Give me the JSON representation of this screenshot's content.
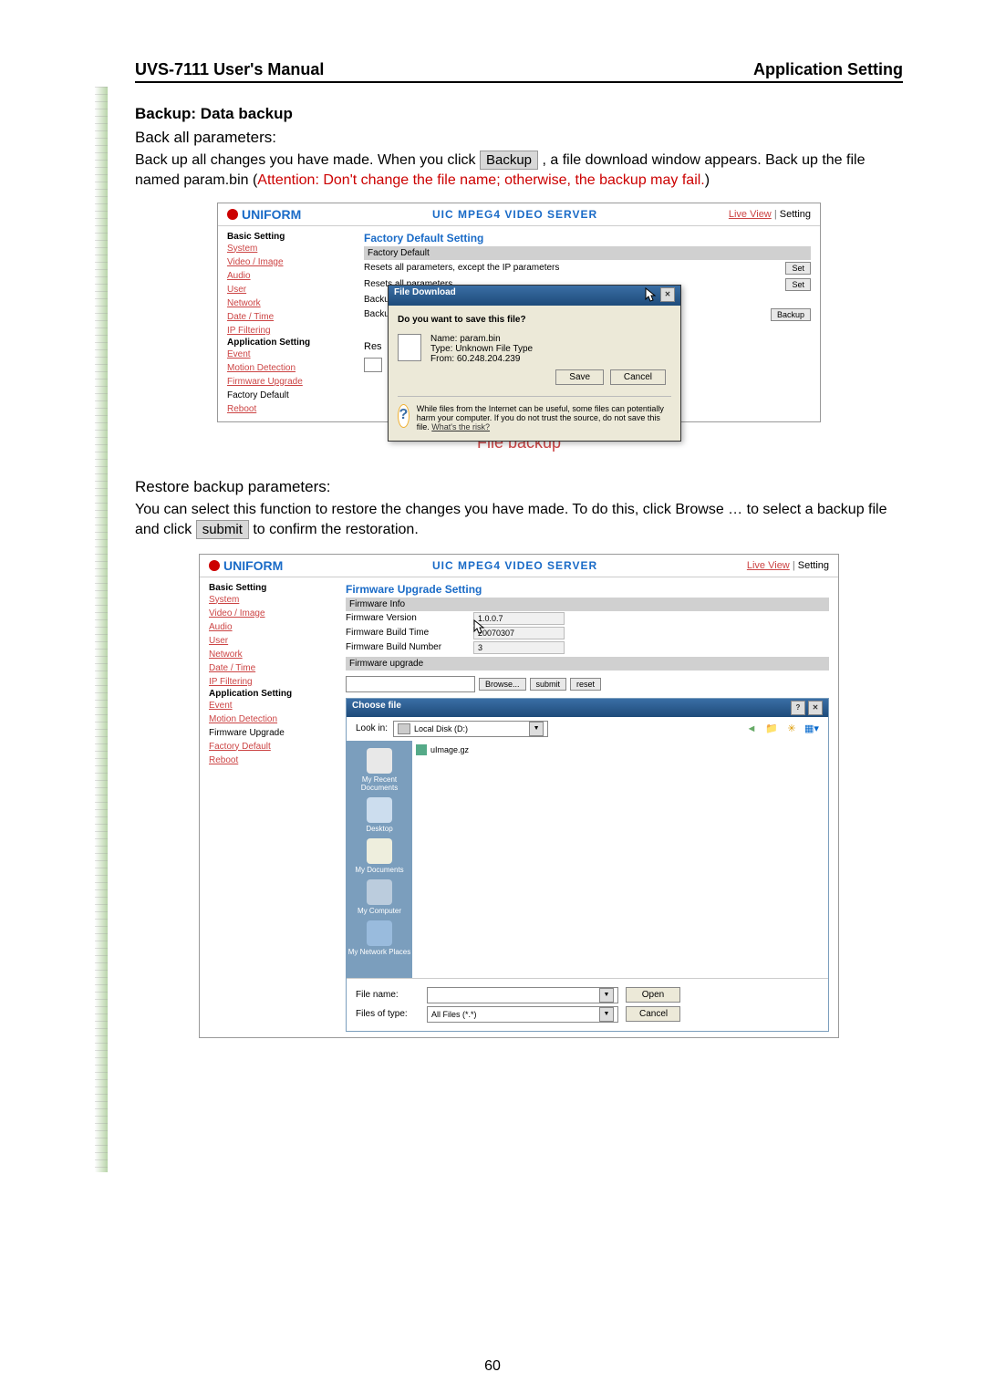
{
  "header": {
    "left": "UVS-7111 User's Manual",
    "right": "Application Setting"
  },
  "section": {
    "title": "Backup: Data backup",
    "subtitle": "Back all parameters:",
    "body_pre": "Back up all changes you have made. When you click ",
    "backup_btn": "Backup",
    "body_post": " , a file download window appears. Back up the file named param.bin (",
    "attention": "Attention: Don't change the file name; otherwise, the backup may fail.",
    "body_close": ")"
  },
  "fig1": {
    "uniform": "UNIFORM",
    "server": "UIC MPEG4 VIDEO SERVER",
    "live": "Live View",
    "setting": "Setting",
    "nav": {
      "basic": "Basic Setting",
      "items": [
        "System",
        "Video / Image",
        "Audio",
        "User",
        "Network",
        "Date / Time",
        "IP Filtering"
      ],
      "app": "Application Setting",
      "app_items": [
        "Event",
        "Motion Detection",
        "Firmware Upgrade",
        "Factory Default",
        "Reboot"
      ]
    },
    "main": {
      "title": "Factory Default Setting",
      "sub": "Factory Default",
      "row1": "Resets all parameters, except the IP parameters",
      "row2": "Resets all parameters",
      "set": "Set",
      "backup_lbl1": "Backup",
      "backup_lbl2": "Backup",
      "backup_btn": "Backup",
      "res": "Res"
    },
    "dialog": {
      "title": "File Download",
      "q": "Do you want to save this file?",
      "name_lbl": "Name:",
      "name": "param.bin",
      "type_lbl": "Type:",
      "type": "Unknown File Type",
      "from_lbl": "From:",
      "from": "60.248.204.239",
      "save": "Save",
      "cancel": "Cancel",
      "warn": "While files from the Internet can be useful, some files can potentially harm your computer. If you do not trust the source, do not save this file. ",
      "link": "What's the risk?"
    }
  },
  "caption1": "File backup",
  "restore": {
    "title": "Restore backup parameters:",
    "body1": "You can select this function to restore the changes you have made. To do this, click ",
    "browse": "Browse",
    "body2": " … to select a backup file and click ",
    "submit": "submit",
    "body3": " to confirm the restoration."
  },
  "fig2": {
    "uniform": "UNIFORM",
    "server": "UIC MPEG4 VIDEO SERVER",
    "live": "Live View",
    "setting": "Setting",
    "nav": {
      "basic": "Basic Setting",
      "items": [
        "System",
        "Video / Image",
        "Audio",
        "User",
        "Network",
        "Date / Time",
        "IP Filtering"
      ],
      "app": "Application Setting",
      "app_items": [
        "Event",
        "Motion Detection"
      ],
      "fw": "Firmware Upgrade",
      "after": [
        "Factory Default",
        "Reboot"
      ]
    },
    "main": {
      "title": "Firmware Upgrade Setting",
      "info": "Firmware Info",
      "ver_lbl": "Firmware Version",
      "ver": "1.0.0.7",
      "bt_lbl": "Firmware Build Time",
      "bt": "20070307",
      "bn_lbl": "Firmware Build Number",
      "bn": "3",
      "upgrade": "Firmware upgrade",
      "browse": "Browse...",
      "submit": "submit",
      "reset": "reset"
    },
    "choose": {
      "title": "Choose file",
      "lookin": "Look in:",
      "disk": "Local Disk (D:)",
      "places": [
        "My Recent Documents",
        "Desktop",
        "My Documents",
        "My Computer",
        "My Network Places"
      ],
      "file": "uImage.gz",
      "fname_lbl": "File name:",
      "fname": "",
      "ftype_lbl": "Files of type:",
      "ftype": "All Files (*.*)",
      "open": "Open",
      "cancel": "Cancel"
    }
  },
  "page_num": "60"
}
